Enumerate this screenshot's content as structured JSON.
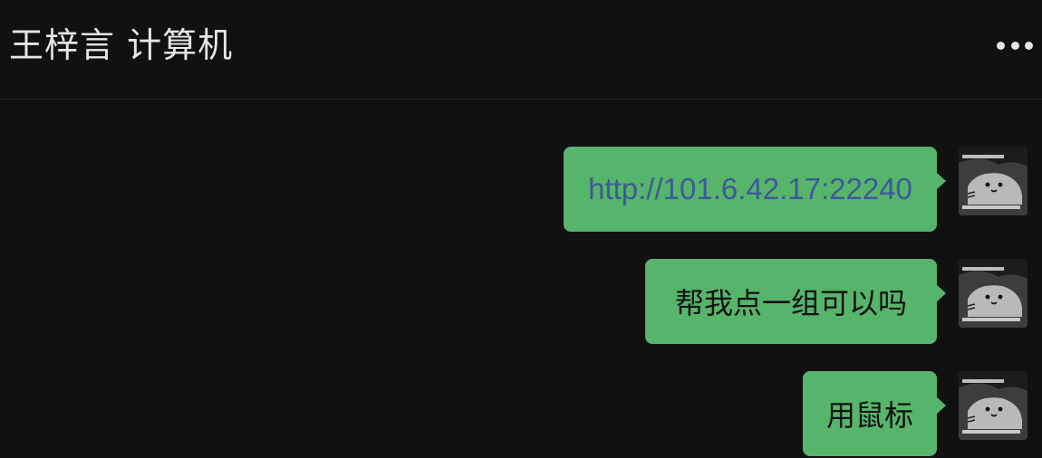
{
  "header": {
    "title": "王梓言 计算机",
    "more_icon": "more-horizontal-icon"
  },
  "messages": [
    {
      "type": "link",
      "text": "http://101.6.42.17:22240",
      "sender": "self"
    },
    {
      "type": "text",
      "text": "帮我点一组可以吗",
      "sender": "self"
    },
    {
      "type": "text",
      "text": "用鼠标",
      "sender": "self"
    }
  ],
  "colors": {
    "background": "#111111",
    "bubble_self": "#57b46b",
    "link": "#3d5a99",
    "title": "#e6e6e6"
  }
}
